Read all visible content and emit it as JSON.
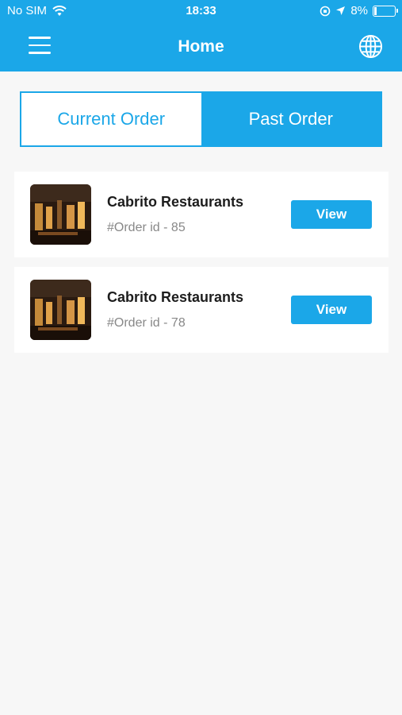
{
  "status_bar": {
    "carrier": "No SIM",
    "time": "18:33",
    "battery": "8%"
  },
  "header": {
    "title": "Home",
    "menu_icon": "hamburger-menu-icon",
    "language_icon": "globe-icon"
  },
  "tabs": [
    {
      "label": "Current Order",
      "active": false
    },
    {
      "label": "Past Order",
      "active": true
    }
  ],
  "orders": [
    {
      "restaurant": "Cabrito Restaurants",
      "order_id": "#Order id - 85",
      "button": "View"
    },
    {
      "restaurant": "Cabrito Restaurants",
      "order_id": "#Order id - 78",
      "button": "View"
    }
  ],
  "colors": {
    "primary": "#1ba7e8",
    "background": "#f7f7f7"
  }
}
